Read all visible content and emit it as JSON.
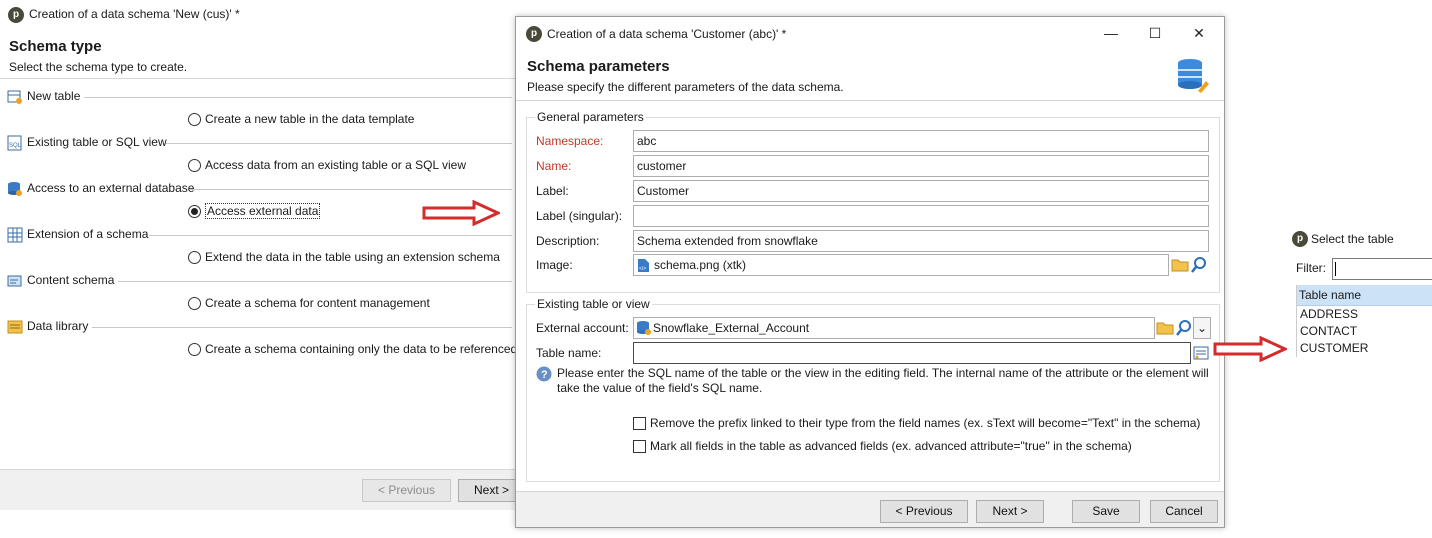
{
  "left_window": {
    "title": "Creation of a data schema 'New (cus)' *",
    "header_title": "Schema type",
    "header_subtitle": "Select the schema type to create.",
    "sections": [
      {
        "label": "New table",
        "option": "Create a new table in the data template",
        "icon": "new-table-icon"
      },
      {
        "label": "Existing table or SQL view",
        "option": "Access data from an existing table or a SQL view",
        "icon": "sql-icon"
      },
      {
        "label": "Access to an external database",
        "option": "Access external data",
        "icon": "external-database-icon"
      },
      {
        "label": "Extension of a schema",
        "option": "Extend the data in the table using an extension schema",
        "icon": "table-grid-icon"
      },
      {
        "label": "Content schema",
        "option": "Create a schema for content management",
        "icon": "content-icon"
      },
      {
        "label": "Data library",
        "option": "Create a schema containing only the data to be referenced",
        "icon": "library-icon"
      }
    ],
    "selected_option_index": 2,
    "buttons": {
      "previous": "< Previous",
      "next": "Next >"
    }
  },
  "dialog": {
    "title": "Creation of a data schema 'Customer (abc)' *",
    "window_controls": {
      "minimize": "—",
      "maximize": "☐",
      "close": "✕"
    },
    "header_title": "Schema parameters",
    "header_subtitle": "Please specify the different parameters of the data schema.",
    "general": {
      "group_title": "General parameters",
      "namespace_label": "Namespace:",
      "namespace_value": "abc",
      "name_label": "Name:",
      "name_value": "customer",
      "label_label": "Label:",
      "label_value": "Customer",
      "label_singular_label": "Label (singular):",
      "label_singular_value": "",
      "description_label": "Description:",
      "description_value": "Schema extended from snowflake",
      "image_label": "Image:",
      "image_value": "schema.png (xtk)"
    },
    "existing": {
      "group_title": "Existing table or view",
      "account_label": "External account:",
      "account_value": "Snowflake_External_Account",
      "table_label": "Table name:",
      "table_value": "",
      "help_text_line1": "Please enter the SQL name of the table or the view in the editing field. The internal name of the attribute or the element will",
      "help_text_line2": "take the value of the field's SQL name.",
      "checkbox_prefix": "Remove the prefix linked to their type from the field names (ex. sText will become=\"Text\" in the schema)",
      "checkbox_advanced": "Mark all fields in the table as advanced fields (ex. advanced attribute=\"true\" in the schema)"
    },
    "buttons": {
      "previous": "< Previous",
      "next": "Next >",
      "save": "Save",
      "cancel": "Cancel"
    }
  },
  "select_table": {
    "title": "Select the table",
    "filter_label": "Filter:",
    "filter_value": "",
    "column_header": "Table name",
    "items": [
      "ADDRESS",
      "CONTACT",
      "CUSTOMER"
    ]
  },
  "colors": {
    "arrow": "#d62b2b",
    "required_label": "#c0392b",
    "list_header": "#cce3f7"
  }
}
